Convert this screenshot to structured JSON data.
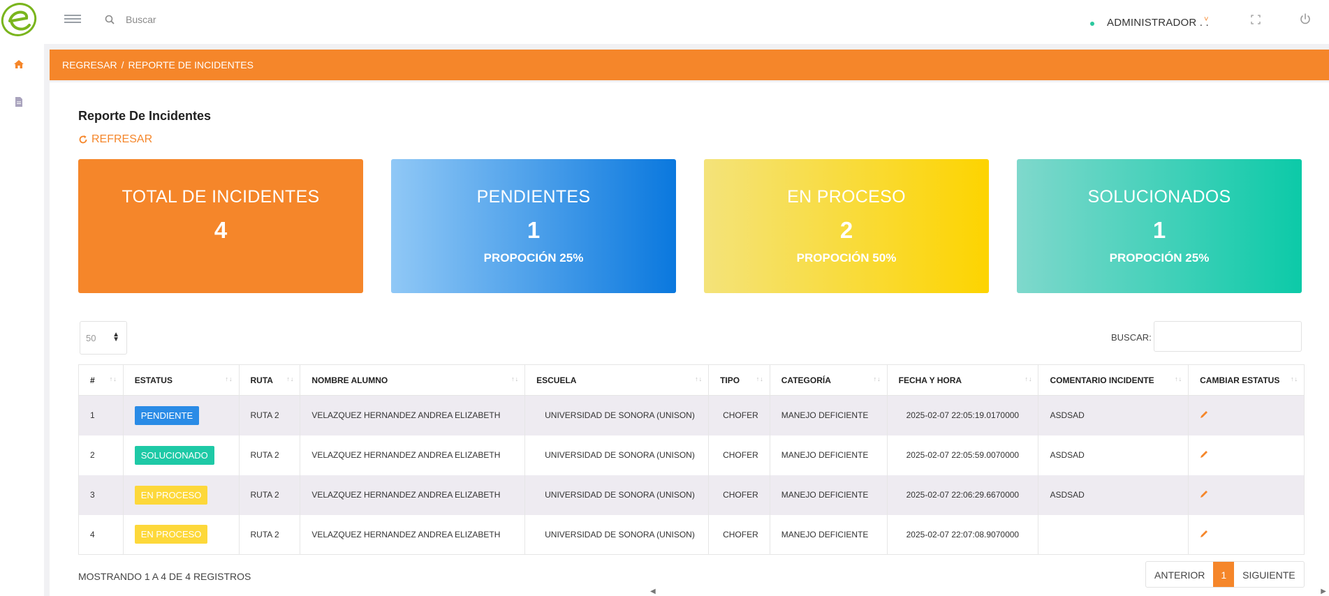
{
  "topbar": {
    "search_placeholder": "Buscar",
    "user_name": "ADMINISTRADOR . .",
    "user_chevron": "˅"
  },
  "breadcrumb": {
    "back": "REGRESAR",
    "separator": "/",
    "current": "REPORTE DE INCIDENTES"
  },
  "page": {
    "title": "Reporte De Incidentes",
    "refresh": "REFRESAR"
  },
  "cards": {
    "total": {
      "title": "TOTAL DE INCIDENTES",
      "value": "4"
    },
    "pending": {
      "title": "PENDIENTES",
      "value": "1",
      "proportion": "PROPOCIÓN 25%"
    },
    "in_process": {
      "title": "EN PROCESO",
      "value": "2",
      "proportion": "PROPOCIÓN 50%"
    },
    "solved": {
      "title": "SOLUCIONADOS",
      "value": "1",
      "proportion": "PROPOCIÓN 25%"
    }
  },
  "table_controls": {
    "page_length": "50",
    "search_label": "BUSCAR:"
  },
  "table": {
    "headers": [
      "#",
      "ESTATUS",
      "RUTA",
      "NOMBRE ALUMNO",
      "ESCUELA",
      "TIPO",
      "CATEGORÍA",
      "FECHA Y HORA",
      "COMENTARIO INCIDENTE",
      "CAMBIAR ESTATUS"
    ],
    "rows": [
      {
        "num": "1",
        "status": "PENDIENTE",
        "route": "RUTA 2",
        "student": "VELAZQUEZ HERNANDEZ ANDREA ELIZABETH",
        "school": "UNIVERSIDAD DE SONORA (UNISON)",
        "type": "CHOFER",
        "category": "MANEJO DEFICIENTE",
        "datetime": "2025-02-07 22:05:19.0170000",
        "comment": "ASDSAD"
      },
      {
        "num": "2",
        "status": "SOLUCIONADO",
        "route": "RUTA 2",
        "student": "VELAZQUEZ HERNANDEZ ANDREA ELIZABETH",
        "school": "UNIVERSIDAD DE SONORA (UNISON)",
        "type": "CHOFER",
        "category": "MANEJO DEFICIENTE",
        "datetime": "2025-02-07 22:05:59.0070000",
        "comment": "ASDSAD"
      },
      {
        "num": "3",
        "status": "EN PROCESO",
        "route": "RUTA 2",
        "student": "VELAZQUEZ HERNANDEZ ANDREA ELIZABETH",
        "school": "UNIVERSIDAD DE SONORA (UNISON)",
        "type": "CHOFER",
        "category": "MANEJO DEFICIENTE",
        "datetime": "2025-02-07 22:06:29.6670000",
        "comment": "ASDSAD"
      },
      {
        "num": "4",
        "status": "EN PROCESO",
        "route": "RUTA 2",
        "student": "VELAZQUEZ HERNANDEZ ANDREA ELIZABETH",
        "school": "UNIVERSIDAD DE SONORA (UNISON)",
        "type": "CHOFER",
        "category": "MANEJO DEFICIENTE",
        "datetime": "2025-02-07 22:07:08.9070000",
        "comment": ""
      }
    ]
  },
  "footer": {
    "info": "MOSTRANDO 1 A 4 DE 4 REGISTROS",
    "prev": "ANTERIOR",
    "current_page": "1",
    "next": "SIGUIENTE"
  },
  "colors": {
    "accent": "#f5862a",
    "pending": "#2a8be6",
    "solved": "#1ec9a6",
    "in_process": "#fdd83a"
  },
  "icons": [
    "logo",
    "menu-icon",
    "search-icon",
    "chevron-down-icon",
    "fullscreen-icon",
    "power-icon",
    "home-icon",
    "document-icon",
    "refresh-icon",
    "sort-icon",
    "edit-icon",
    "scroll-left-icon",
    "scroll-right-icon"
  ]
}
